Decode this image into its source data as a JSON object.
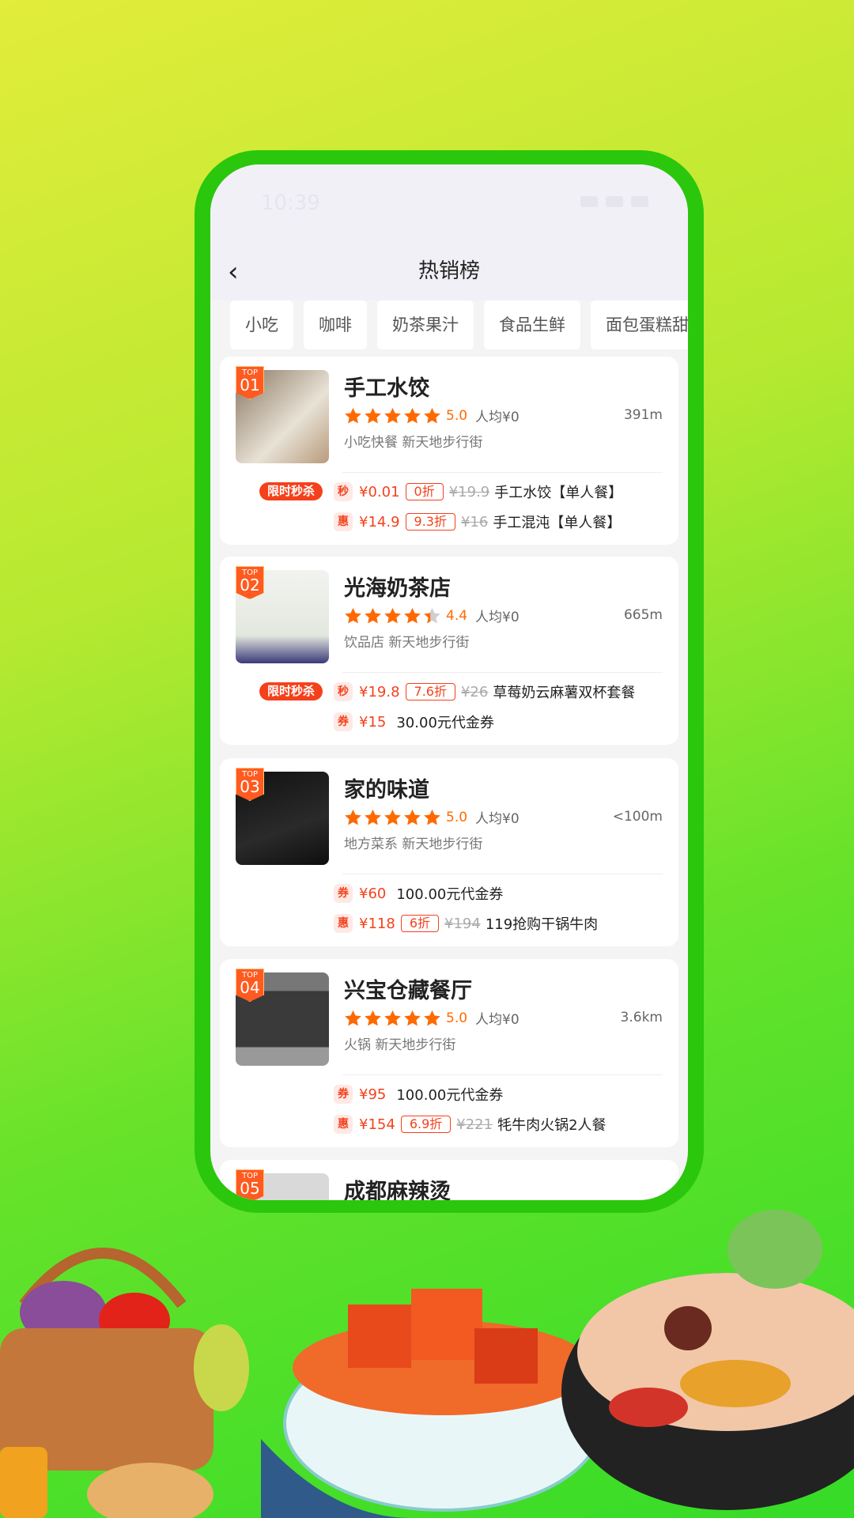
{
  "status_bar": {
    "time": "10:39"
  },
  "nav": {
    "title": "热销榜",
    "back_icon": "chevron-left-icon"
  },
  "tabs": [
    "小吃",
    "咖啡",
    "奶茶果汁",
    "食品生鲜",
    "面包蛋糕甜"
  ],
  "colors": {
    "accent": "#f4411c",
    "star": "#ff6a00",
    "frame": "#2ac70c"
  },
  "shops": [
    {
      "rank_label": "TOP",
      "rank": "01",
      "name": "手工水饺",
      "rating": 5.0,
      "score": "5.0",
      "avg": "人均¥0",
      "distance": "391m",
      "category": "小吃快餐  新天地步行街",
      "flash": "限时秒杀",
      "deals": [
        {
          "icon": "秒",
          "price": "¥0.01",
          "discount": "0折",
          "original": "¥19.9",
          "title": "手工水饺【单人餐】"
        },
        {
          "icon": "惠",
          "price": "¥14.9",
          "discount": "9.3折",
          "original": "¥16",
          "title": "手工混沌【单人餐】"
        }
      ]
    },
    {
      "rank_label": "TOP",
      "rank": "02",
      "name": "光海奶茶店",
      "rating": 4.4,
      "score": "4.4",
      "avg": "人均¥0",
      "distance": "665m",
      "category": "饮品店  新天地步行街",
      "flash": "限时秒杀",
      "deals": [
        {
          "icon": "秒",
          "price": "¥19.8",
          "discount": "7.6折",
          "original": "¥26",
          "title": "草莓奶云麻薯双杯套餐"
        },
        {
          "icon": "券",
          "price": "¥15",
          "title": "30.00元代金券"
        }
      ]
    },
    {
      "rank_label": "TOP",
      "rank": "03",
      "name": "家的味道",
      "rating": 5.0,
      "score": "5.0",
      "avg": "人均¥0",
      "distance": "<100m",
      "category": "地方菜系  新天地步行街",
      "deals": [
        {
          "icon": "券",
          "price": "¥60",
          "title": "100.00元代金券"
        },
        {
          "icon": "惠",
          "price": "¥118",
          "discount": "6折",
          "original": "¥194",
          "title": "119抢购干锅牛肉"
        }
      ]
    },
    {
      "rank_label": "TOP",
      "rank": "04",
      "name": "兴宝仓藏餐厅",
      "rating": 5.0,
      "score": "5.0",
      "avg": "人均¥0",
      "distance": "3.6km",
      "category": "火锅  新天地步行街",
      "deals": [
        {
          "icon": "券",
          "price": "¥95",
          "title": "100.00元代金券"
        },
        {
          "icon": "惠",
          "price": "¥154",
          "discount": "6.9折",
          "original": "¥221",
          "title": "牦牛肉火锅2人餐"
        }
      ]
    },
    {
      "rank_label": "TOP",
      "rank": "05",
      "name": "成都麻辣烫"
    }
  ]
}
